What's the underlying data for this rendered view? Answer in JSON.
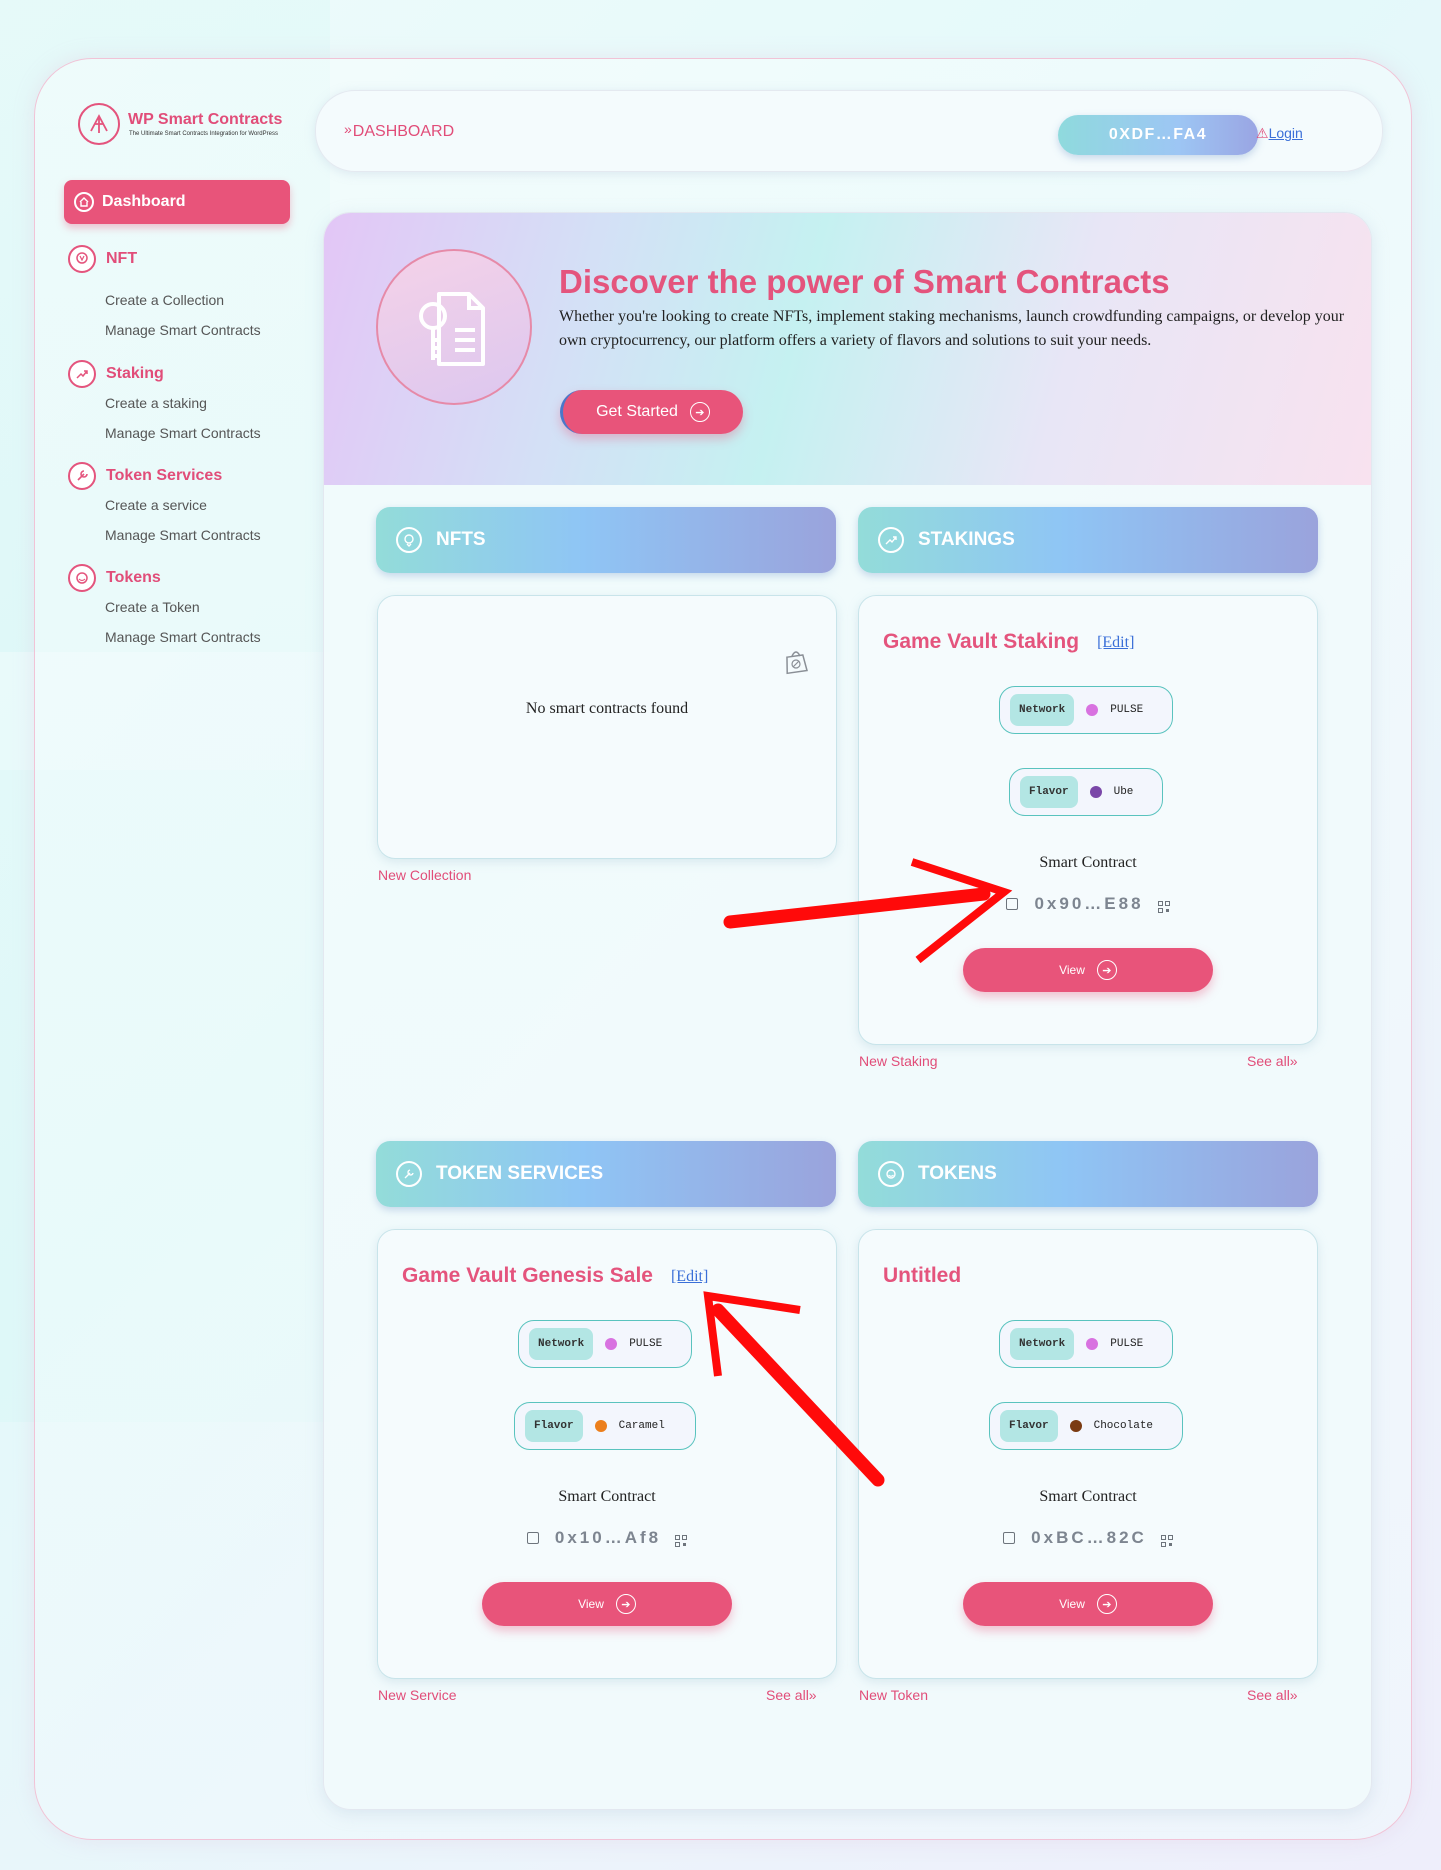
{
  "app": {
    "logo_title": "WP Smart Contracts",
    "logo_tagline": "The Ultimate Smart Contracts Integration for WordPress"
  },
  "sidebar": {
    "active_label": "Dashboard",
    "groups": [
      {
        "label": "NFT",
        "icon": "nft-icon",
        "items": [
          "Create a Collection",
          "Manage Smart Contracts"
        ]
      },
      {
        "label": "Staking",
        "icon": "staking-icon",
        "items": [
          "Create a staking",
          "Manage Smart Contracts"
        ]
      },
      {
        "label": "Token Services",
        "icon": "wrench-icon",
        "items": [
          "Create a service",
          "Manage Smart Contracts"
        ]
      },
      {
        "label": "Tokens",
        "icon": "coin-icon",
        "items": [
          "Create a Token",
          "Manage Smart Contracts"
        ]
      }
    ]
  },
  "topbar": {
    "breadcrumb_chevron": "»",
    "breadcrumb": "DASHBOARD",
    "wallet": "0XDF…FA4",
    "login_warning": "⚠",
    "login": "Login"
  },
  "hero": {
    "title": "Discover the power of Smart Contracts",
    "text": "Whether you're looking to create NFTs, implement staking mechanisms, launch crowdfunding campaigns, or develop your own cryptocurrency, our platform offers a variety of flavors and solutions to suit your needs.",
    "cta": "Get Started"
  },
  "sections": {
    "nfts": {
      "title": "NFTS",
      "empty": "No smart contracts found",
      "new_link": "New Collection"
    },
    "stakings": {
      "title": "STAKINGS",
      "card_title": "Game Vault Staking",
      "edit": "[Edit]",
      "network_tag": "Network",
      "network": "PULSE",
      "network_color": "#d872e0",
      "flavor_tag": "Flavor",
      "flavor": "Ube",
      "flavor_color": "#7a47a8",
      "sc_label": "Smart Contract",
      "address": "0x90…E88",
      "view": "View",
      "new_link": "New Staking",
      "see_all": "See all»"
    },
    "token_services": {
      "title": "TOKEN SERVICES",
      "card_title": "Game Vault Genesis Sale",
      "edit": "[Edit]",
      "network_tag": "Network",
      "network": "PULSE",
      "network_color": "#d872e0",
      "flavor_tag": "Flavor",
      "flavor": "Caramel",
      "flavor_color": "#ec7f1c",
      "sc_label": "Smart Contract",
      "address": "0x10…Af8",
      "view": "View",
      "new_link": "New Service",
      "see_all": "See all»"
    },
    "tokens": {
      "title": "TOKENS",
      "card_title": "Untitled",
      "network_tag": "Network",
      "network": "PULSE",
      "network_color": "#d872e0",
      "flavor_tag": "Flavor",
      "flavor": "Chocolate",
      "flavor_color": "#7b3b12",
      "sc_label": "Smart Contract",
      "address": "0xBC…82C",
      "view": "View",
      "new_link": "New Token",
      "see_all": "See all»"
    }
  },
  "colors": {
    "accent": "#e8547a",
    "annotation_arrow": "#ff0a0a"
  }
}
